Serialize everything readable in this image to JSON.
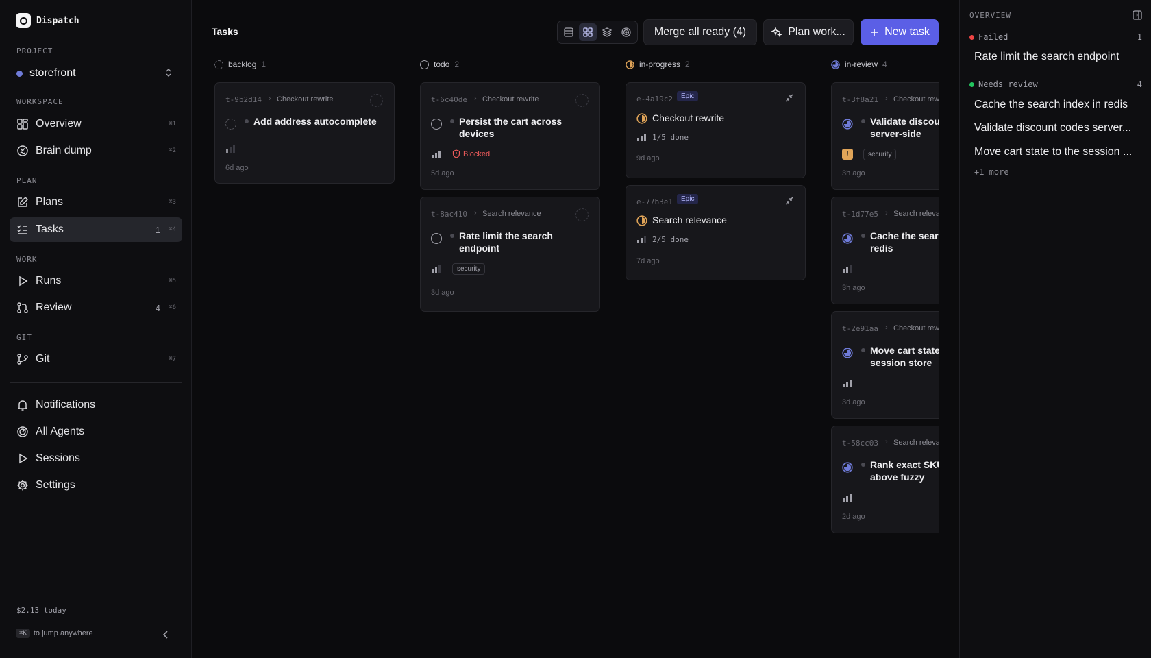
{
  "app": {
    "name": "Dispatch"
  },
  "sidebar": {
    "project_label": "PROJECT",
    "project_name": "storefront",
    "sections": {
      "workspace": "WORKSPACE",
      "plan": "PLAN",
      "work": "WORK",
      "git": "GIT"
    },
    "items": [
      {
        "label": "Overview",
        "kbd": "⌘1",
        "count": ""
      },
      {
        "label": "Brain dump",
        "kbd": "⌘2",
        "count": ""
      },
      {
        "label": "Plans",
        "kbd": "⌘3",
        "count": ""
      },
      {
        "label": "Tasks",
        "kbd": "⌘4",
        "count": "1"
      },
      {
        "label": "Runs",
        "kbd": "⌘5",
        "count": ""
      },
      {
        "label": "Review",
        "kbd": "⌘6",
        "count": "4"
      },
      {
        "label": "Git",
        "kbd": "⌘7",
        "count": ""
      },
      {
        "label": "Notifications"
      },
      {
        "label": "All Agents"
      },
      {
        "label": "Sessions"
      },
      {
        "label": "Settings"
      }
    ],
    "cost": "$2.13 today",
    "jump_key": "⌘K",
    "jump_text": "to jump anywhere"
  },
  "main": {
    "title": "Tasks",
    "buttons": {
      "merge": "Merge all ready (4)",
      "plan": "Plan work...",
      "new_task": "New task"
    },
    "columns": [
      {
        "name": "backlog",
        "count": "1"
      },
      {
        "name": "todo",
        "count": "2"
      },
      {
        "name": "in-progress",
        "count": "2"
      },
      {
        "name": "in-review",
        "count": "4"
      }
    ],
    "cards": {
      "backlog": [
        {
          "id": "t-9b2d14",
          "parent": "Checkout rewrite",
          "title": "Add address autocomplete",
          "age": "6d ago"
        }
      ],
      "todo": [
        {
          "id": "t-6c40de",
          "parent": "Checkout rewrite",
          "title_l1": "Persist the cart across",
          "title_l2": "devices",
          "blocked": "Blocked",
          "age": "5d ago"
        },
        {
          "id": "t-8ac410",
          "parent": "Search relevance",
          "title_l1": "Rate limit the search",
          "title_l2": "endpoint",
          "tag": "security",
          "age": "3d ago"
        }
      ],
      "in_progress": [
        {
          "id": "e-4a19c2",
          "badge": "Epic",
          "title": "Checkout rewrite",
          "progress": "1/5 done",
          "age": "9d ago"
        },
        {
          "id": "e-77b3e1",
          "badge": "Epic",
          "title": "Search relevance",
          "progress": "2/5 done",
          "age": "7d ago"
        }
      ],
      "in_review": [
        {
          "id": "t-3f8a21",
          "parent": "Checkout rew",
          "title_l1": "Validate discou",
          "title_l2": "server-side",
          "tag": "security",
          "age": "3h ago"
        },
        {
          "id": "t-1d77e5",
          "parent": "Search releva",
          "title_l1": "Cache the searc",
          "title_l2": "redis",
          "age": "3h ago"
        },
        {
          "id": "t-2e91aa",
          "parent": "Checkout rew",
          "title_l1": "Move cart state",
          "title_l2": "session store",
          "age": "3d ago"
        },
        {
          "id": "t-58cc03",
          "parent": "Search releva",
          "title_l1": "Rank exact SKU",
          "title_l2": "above fuzzy",
          "age": "2d ago"
        }
      ]
    }
  },
  "overview": {
    "title": "OVERVIEW",
    "failed": {
      "label": "Failed",
      "count": "1",
      "items": [
        "Rate limit the search endpoint"
      ]
    },
    "needs_review": {
      "label": "Needs review",
      "count": "4",
      "items": [
        "Cache the search index in redis",
        "Validate discount codes server...",
        "Move cart state to the session ..."
      ]
    },
    "more": "+1 more"
  },
  "colors": {
    "accent": "#5b5fe6",
    "failed": "#ef4444",
    "review": "#22c55e",
    "blocked": "#ef5b5b",
    "in_progress": "#e0a458",
    "in_review": "#6f7bd8"
  }
}
